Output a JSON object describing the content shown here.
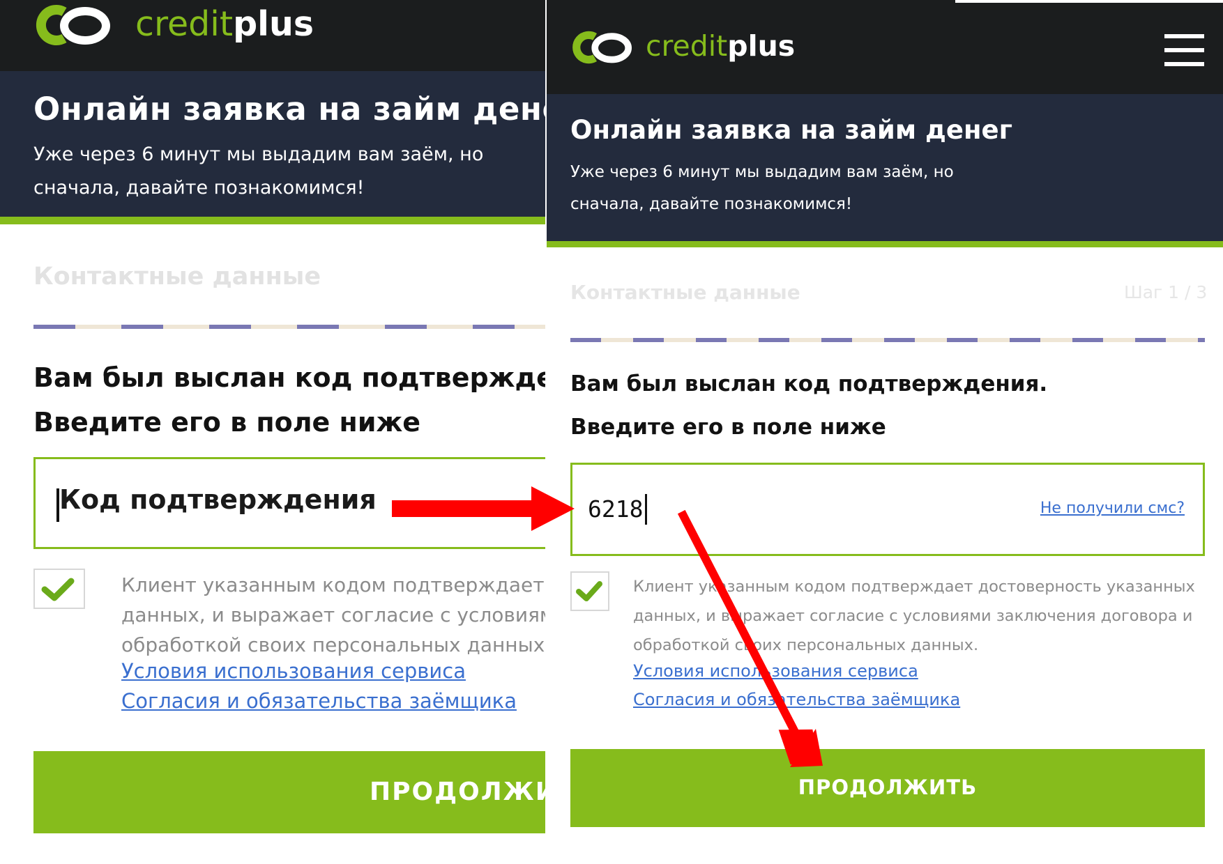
{
  "brand": {
    "part1": "credit",
    "part2": "plus"
  },
  "hero": {
    "title": "Онлайн заявка на займ денег",
    "subtitle_line1": "Уже через 6 минут мы выдадим вам заём, но",
    "subtitle_line2": "сначала, давайте познакомимся!"
  },
  "form": {
    "section_title": "Контактные данные",
    "step": "Шаг 1 / 3",
    "instruction_line1": "Вам был выслан код подтверждения.",
    "instruction_line2": "Введите его в поле ниже",
    "code_placeholder": "Код подтверждения",
    "code_value": "6218",
    "resend_link": "Не получили смс?",
    "consent_line1": "Клиент указанным кодом подтверждает достоверность указанных",
    "consent_line2": "данных, и выражает согласие с условиями заключения договора и",
    "consent_line3": "обработкой своих персональных данных.",
    "link_terms": "Условия использования сервиса",
    "link_obligations": "Согласия и обязательства заёмщика",
    "submit_label": "ПРОДОЛЖИТЬ",
    "consent_checked": true
  },
  "colors": {
    "accent_green": "#86bc1c",
    "header_dark": "#1b1d1e",
    "hero_navy": "#232b3d",
    "link_blue": "#3a6fcf",
    "annotation_arrow": "#ff0000"
  },
  "icons": {
    "menu": "hamburger-icon",
    "check": "checkmark-icon",
    "logo": "creditplus-logo-icon"
  }
}
